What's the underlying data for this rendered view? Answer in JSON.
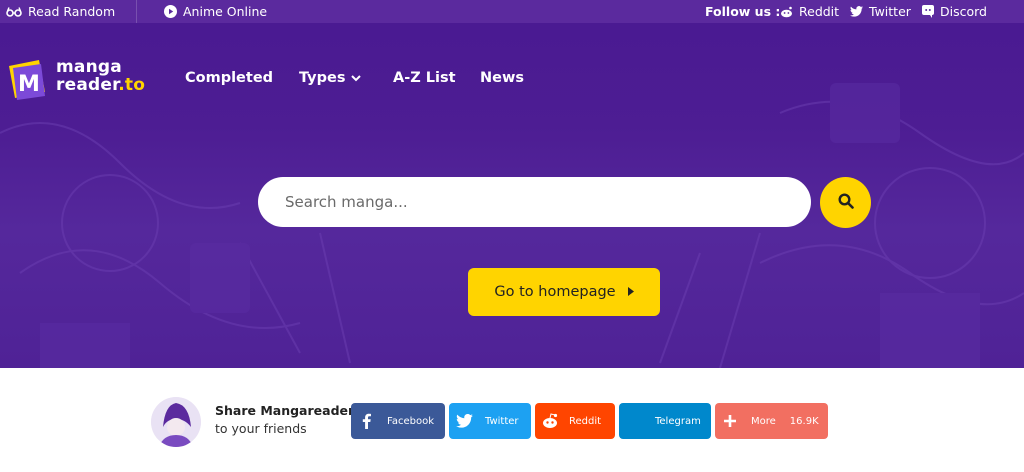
{
  "topbar": {
    "read_random": "Read Random",
    "anime_online": "Anime Online",
    "follow_label": "Follow us :",
    "reddit": "Reddit",
    "twitter": "Twitter",
    "discord": "Discord"
  },
  "logo": {
    "line1": "manga",
    "line2a": "reader",
    "line2b": ".to",
    "mark_letter": "M"
  },
  "nav": {
    "completed": "Completed",
    "types": "Types",
    "az_list": "A-Z List",
    "news": "News"
  },
  "search": {
    "placeholder": "Search manga..."
  },
  "home_button": {
    "label": "Go to homepage"
  },
  "share": {
    "title": "Share Mangareader",
    "subtitle": "to your friends",
    "buttons": [
      {
        "label": "Facebook",
        "color": "#3b5998"
      },
      {
        "label": "Twitter",
        "color": "#1da1f2"
      },
      {
        "label": "Reddit",
        "color": "#ff4500"
      },
      {
        "label": "Telegram",
        "color": "#0088cc"
      },
      {
        "label": "More",
        "count": "16.9K",
        "color": "#f26f61"
      }
    ]
  },
  "colors": {
    "accent": "#ffd400",
    "header": "#5b2a9e",
    "hero": "#4d1d93"
  }
}
